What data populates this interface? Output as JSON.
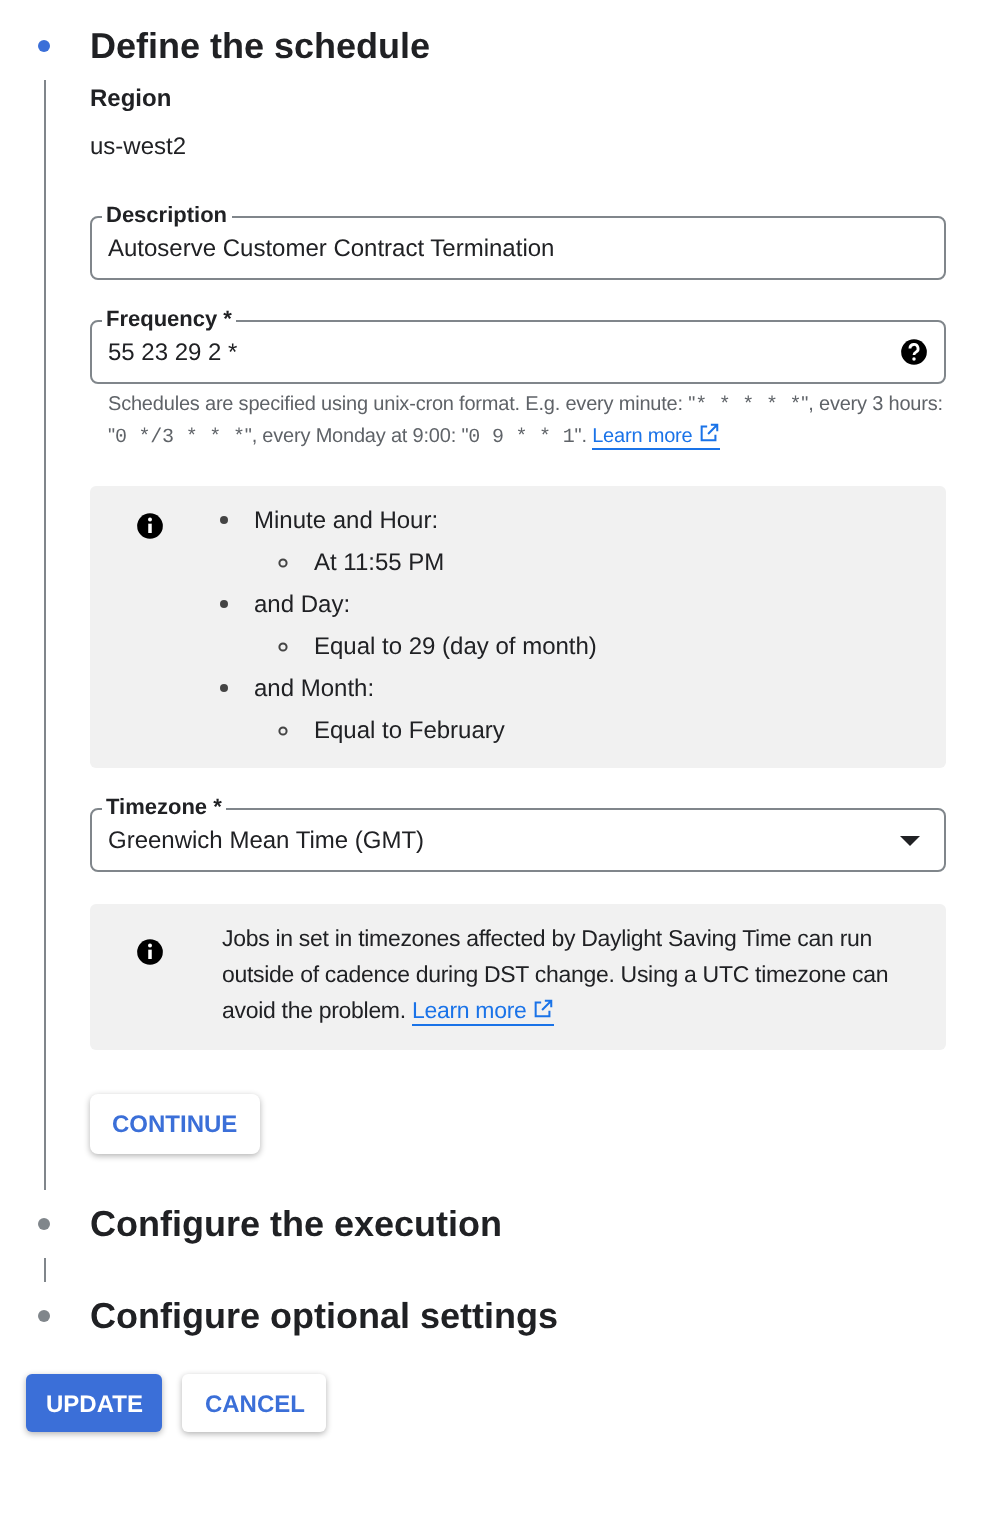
{
  "steps": [
    {
      "title": "Define the schedule",
      "active": true
    },
    {
      "title": "Configure the execution",
      "active": false
    },
    {
      "title": "Configure optional settings",
      "active": false
    }
  ],
  "region": {
    "label": "Region",
    "value": "us-west2"
  },
  "description": {
    "label": "Description",
    "value": "Autoserve Customer Contract Termination"
  },
  "frequency": {
    "label": "Frequency *",
    "value": "55 23 29 2 *",
    "hint": [
      {
        "kind": "plain",
        "text": "Schedules are specified using unix-cron format. E.g. every minute: \""
      },
      {
        "kind": "code",
        "text": "* * * * *"
      },
      {
        "kind": "plain",
        "text": "\", every 3 hours: \""
      },
      {
        "kind": "code",
        "text": "0 */3 * * *"
      },
      {
        "kind": "plain",
        "text": "\", every Monday at 9:00: \""
      },
      {
        "kind": "code",
        "text": "0 9 * * 1"
      },
      {
        "kind": "plain",
        "text": "\". "
      }
    ],
    "hint_link": "Learn more"
  },
  "schedule_summary": [
    {
      "text": "Minute and Hour:",
      "children": [
        {
          "text": "At 11:55 PM"
        }
      ]
    },
    {
      "text": "and Day:",
      "children": [
        {
          "text": "Equal to 29 (day of month)"
        }
      ]
    },
    {
      "text": "and Month:",
      "children": [
        {
          "text": "Equal to February"
        }
      ]
    }
  ],
  "timezone": {
    "label": "Timezone *",
    "value": "Greenwich Mean Time (GMT)"
  },
  "dst_notice": {
    "text": "Jobs in set in timezones affected by Daylight Saving Time can run outside of cadence during DST change. Using a UTC timezone can avoid the problem. ",
    "link": "Learn more"
  },
  "continue_button": "CONTINUE",
  "buttons": [
    {
      "label": "UPDATE",
      "kind": "primary"
    },
    {
      "label": "CANCEL",
      "kind": "secondary"
    }
  ]
}
